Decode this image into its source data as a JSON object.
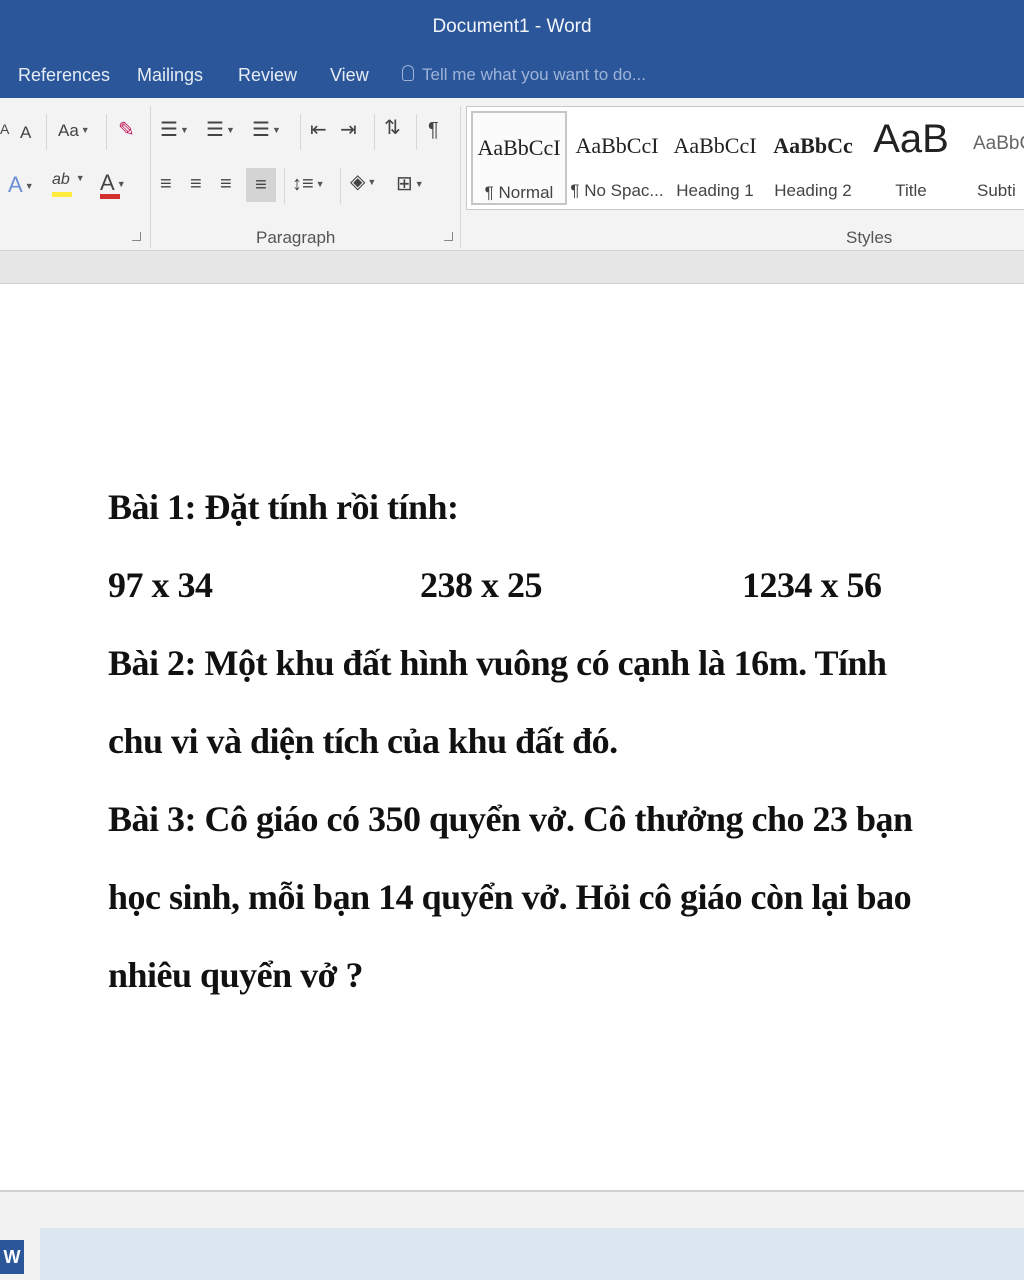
{
  "window": {
    "title": "Document1 - Word"
  },
  "tabs": [
    "References",
    "Mailings",
    "Review",
    "View"
  ],
  "tellme": {
    "placeholder": "Tell me what you want to do..."
  },
  "ribbon": {
    "font_group": {
      "grow_label": "A",
      "shrink_label": "A",
      "case_label": "Aa",
      "highlight_label": "ab",
      "color_label": "A",
      "text_effects_label": "A"
    },
    "paragraph_group": {
      "label": "Paragraph",
      "pilcrow": "¶"
    },
    "styles_group": {
      "label": "Styles",
      "items": [
        {
          "preview": "AaBbCcI",
          "name": "¶ Normal",
          "selected": true
        },
        {
          "preview": "AaBbCcI",
          "name": "¶ No Spac..."
        },
        {
          "preview": "AaBbCcI",
          "name": "Heading 1"
        },
        {
          "preview": "AaBbCc",
          "name": "Heading 2"
        },
        {
          "preview": "AaB",
          "name": "Title"
        },
        {
          "preview": "AaBbC",
          "name": "Subti"
        }
      ]
    }
  },
  "colors": {
    "title_bar": "#2b579a",
    "highlight": "#ffeb3b",
    "font_color": "#d32f2f"
  },
  "document": {
    "exercise1_title": "Bài 1: Đặt tính rồi tính:",
    "exercise1_calcs": [
      "97 x 34",
      "238 x 25",
      "1234 x 56"
    ],
    "exercise2_line1": "Bài 2: Một khu đất hình vuông có cạnh là 16m. Tính",
    "exercise2_line2": "chu vi và diện tích của khu đất đó.",
    "exercise3_line1": "Bài 3: Cô giáo có 350 quyển vở. Cô thưởng cho 23 bạn",
    "exercise3_line2": "học sinh, mỗi bạn 14 quyển vở. Hỏi cô giáo còn lại bao",
    "exercise3_line3": "nhiêu quyển vở ?"
  },
  "taskbar": {
    "word_icon_label": "W"
  }
}
